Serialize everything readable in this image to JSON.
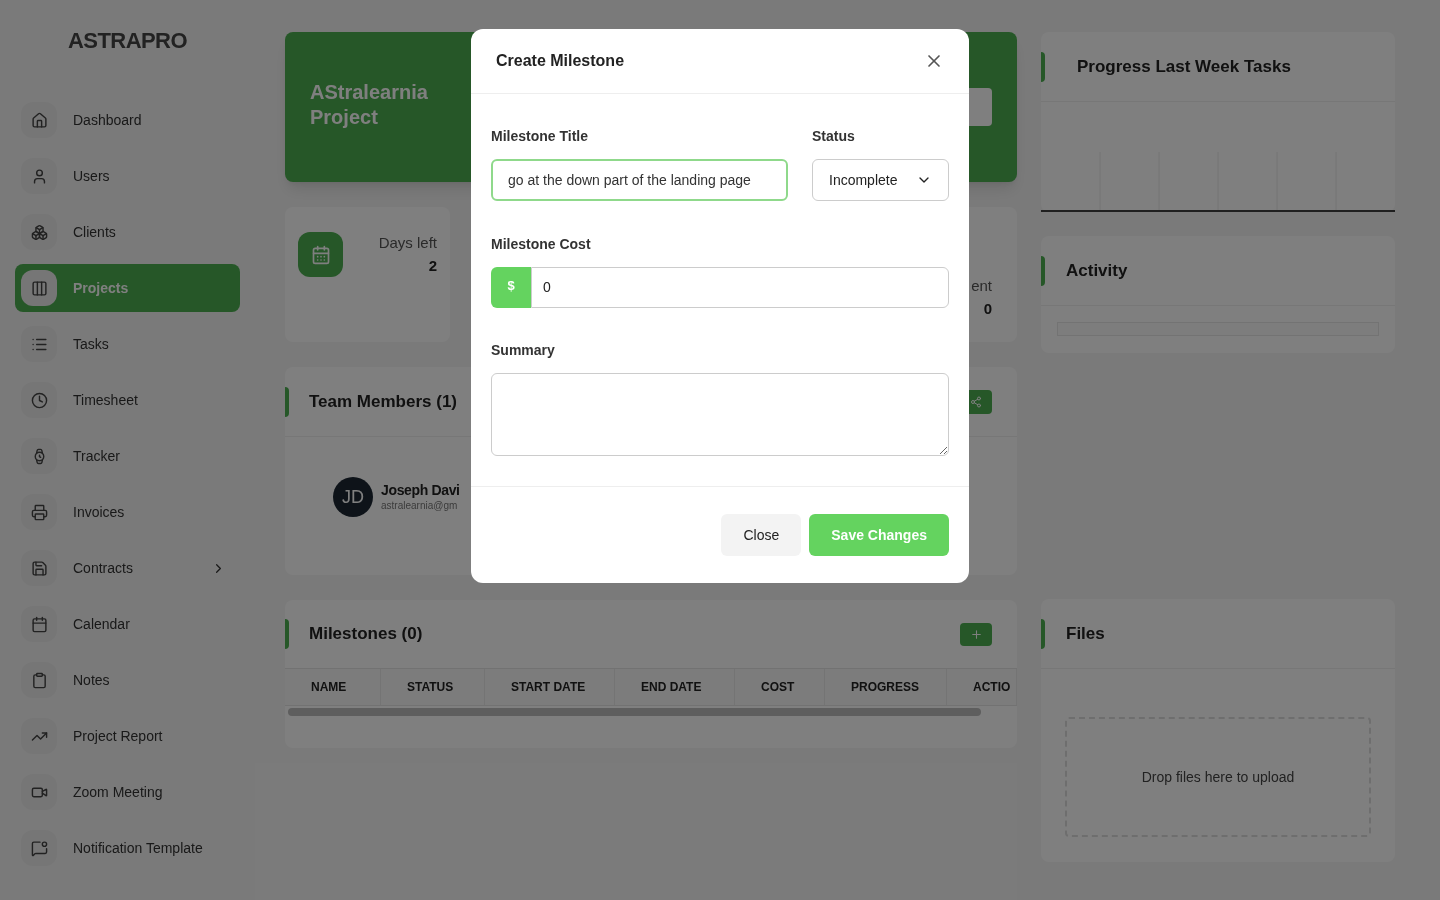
{
  "logo": "ASTRA**PRO**",
  "sidebar": {
    "items": [
      {
        "label": "Dashboard",
        "selected": false,
        "expandable": false
      },
      {
        "label": "Users",
        "selected": false,
        "expandable": false
      },
      {
        "label": "Clients",
        "selected": false,
        "expandable": false
      },
      {
        "label": "Projects",
        "selected": true,
        "expandable": false
      },
      {
        "label": "Tasks",
        "selected": false,
        "expandable": false
      },
      {
        "label": "Timesheet",
        "selected": false,
        "expandable": false
      },
      {
        "label": "Tracker",
        "selected": false,
        "expandable": false
      },
      {
        "label": "Invoices",
        "selected": false,
        "expandable": false
      },
      {
        "label": "Contracts",
        "selected": false,
        "expandable": true
      },
      {
        "label": "Calendar",
        "selected": false,
        "expandable": false
      },
      {
        "label": "Notes",
        "selected": false,
        "expandable": false
      },
      {
        "label": "Project Report",
        "selected": false,
        "expandable": false
      },
      {
        "label": "Zoom Meeting",
        "selected": false,
        "expandable": false
      },
      {
        "label": "Notification Template",
        "selected": false,
        "expandable": false
      }
    ]
  },
  "project": {
    "title": "AStralearnia Project"
  },
  "stats": [
    {
      "label": "Days left",
      "value": "2"
    },
    {
      "label": "ent",
      "value": "0"
    }
  ],
  "team": {
    "title": "Team Members (1)",
    "members": [
      {
        "initials": "JD",
        "name": "Joseph Davi",
        "email": "astralearnia@gm"
      }
    ]
  },
  "milestones": {
    "title": "Milestones (0)",
    "columns": [
      "NAME",
      "STATUS",
      "START DATE",
      "END DATE",
      "COST",
      "PROGRESS",
      "ACTIO"
    ]
  },
  "progress": {
    "title": "Progress Last Week Tasks"
  },
  "activity": {
    "title": "Activity"
  },
  "files": {
    "title": "Files",
    "dropzone": "Drop files here to upload"
  },
  "modal": {
    "title": "Create Milestone",
    "fields": [
      {
        "label": "Milestone Title",
        "value": "go at the down part of the landing page"
      },
      {
        "label": "Status",
        "value": "Incomplete"
      },
      {
        "label": "Milestone Cost",
        "prefix": "$",
        "value": "0"
      },
      {
        "label": "Summary"
      }
    ],
    "buttons": [
      "Close",
      "Save Changes"
    ]
  }
}
